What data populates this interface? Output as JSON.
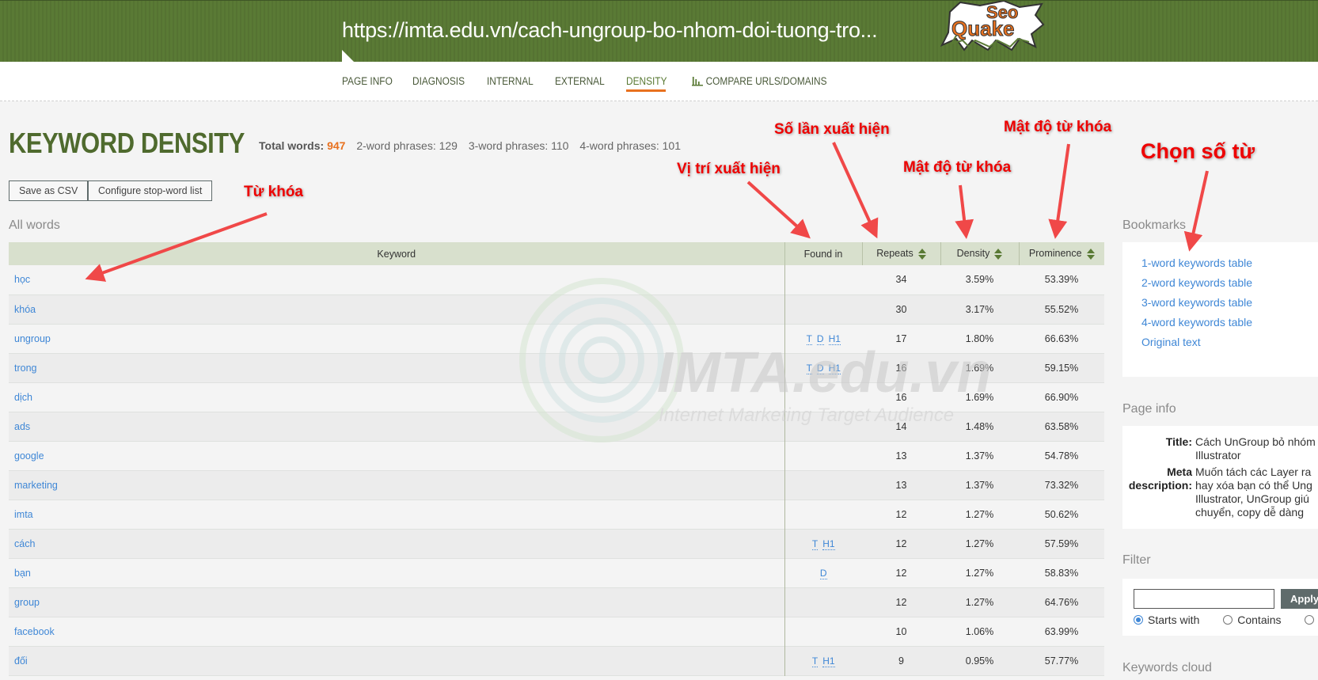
{
  "header": {
    "url": "https://imta.edu.vn/cach-ungroup-bo-nhom-doi-tuong-tro...",
    "logo_top": "Seo",
    "logo_bottom": "Quake"
  },
  "nav": {
    "items": [
      {
        "label": "PAGE INFO"
      },
      {
        "label": "DIAGNOSIS"
      },
      {
        "label": "INTERNAL"
      },
      {
        "label": "EXTERNAL"
      },
      {
        "label": "DENSITY",
        "active": true
      },
      {
        "label": "COMPARE URLS/DOMAINS",
        "icon": "bar-chart-icon"
      }
    ],
    "accent_color": "#e8711f"
  },
  "page": {
    "title": "KEYWORD DENSITY",
    "stats": {
      "total_words_label": "Total words:",
      "total_words": "947",
      "two_word_label": "2-word phrases:",
      "two_word": "129",
      "three_word_label": "3-word phrases:",
      "three_word": "110",
      "four_word_label": "4-word phrases:",
      "four_word": "101"
    },
    "buttons": {
      "save_csv": "Save as CSV",
      "configure": "Configure stop-word list"
    },
    "section_label": "All words"
  },
  "table": {
    "columns": {
      "keyword": "Keyword",
      "found_in": "Found in",
      "repeats": "Repeats",
      "density": "Density",
      "prominence": "Prominence"
    },
    "rows": [
      {
        "keyword": "học",
        "found_in": [],
        "repeats": "34",
        "density": "3.59%",
        "prominence": "53.39%"
      },
      {
        "keyword": "khóa",
        "found_in": [],
        "repeats": "30",
        "density": "3.17%",
        "prominence": "55.52%"
      },
      {
        "keyword": "ungroup",
        "found_in": [
          "T",
          "D",
          "H1"
        ],
        "repeats": "17",
        "density": "1.80%",
        "prominence": "66.63%"
      },
      {
        "keyword": "trong",
        "found_in": [
          "T",
          "D",
          "H1"
        ],
        "repeats": "16",
        "density": "1.69%",
        "prominence": "59.15%"
      },
      {
        "keyword": "dịch",
        "found_in": [],
        "repeats": "16",
        "density": "1.69%",
        "prominence": "66.90%"
      },
      {
        "keyword": "ads",
        "found_in": [],
        "repeats": "14",
        "density": "1.48%",
        "prominence": "63.58%"
      },
      {
        "keyword": "google",
        "found_in": [],
        "repeats": "13",
        "density": "1.37%",
        "prominence": "54.78%"
      },
      {
        "keyword": "marketing",
        "found_in": [],
        "repeats": "13",
        "density": "1.37%",
        "prominence": "73.32%"
      },
      {
        "keyword": "imta",
        "found_in": [],
        "repeats": "12",
        "density": "1.27%",
        "prominence": "50.62%"
      },
      {
        "keyword": "cách",
        "found_in": [
          "T",
          "H1"
        ],
        "repeats": "12",
        "density": "1.27%",
        "prominence": "57.59%"
      },
      {
        "keyword": "bạn",
        "found_in": [
          "D"
        ],
        "repeats": "12",
        "density": "1.27%",
        "prominence": "58.83%"
      },
      {
        "keyword": "group",
        "found_in": [],
        "repeats": "12",
        "density": "1.27%",
        "prominence": "64.76%"
      },
      {
        "keyword": "facebook",
        "found_in": [],
        "repeats": "10",
        "density": "1.06%",
        "prominence": "63.99%"
      },
      {
        "keyword": "đối",
        "found_in": [
          "T",
          "H1"
        ],
        "repeats": "9",
        "density": "0.95%",
        "prominence": "57.77%"
      }
    ]
  },
  "sidebar": {
    "bookmarks_label": "Bookmarks",
    "bookmarks": [
      "1-word keywords table",
      "2-word keywords table",
      "3-word keywords table",
      "4-word keywords table",
      "Original text"
    ],
    "page_info_label": "Page info",
    "page_info": {
      "title_label": "Title:",
      "title_lines": [
        "Cách UnGroup bỏ nhóm",
        "Illustrator"
      ],
      "meta_label_1": "Meta",
      "meta_label_2": "description:",
      "meta_lines": [
        "Muốn tách các Layer ra",
        "hay xóa bạn có thể Ung",
        "Illustrator, UnGroup giú",
        "chuyển, copy dễ dàng"
      ]
    },
    "filter_label": "Filter",
    "filter": {
      "value": "",
      "apply": "Apply",
      "options": [
        {
          "label": "Starts with",
          "checked": true
        },
        {
          "label": "Contains",
          "checked": false
        },
        {
          "label": "",
          "checked": false
        }
      ]
    },
    "cloud_label": "Keywords cloud"
  },
  "annotations": {
    "keyword": "Từ khóa",
    "position": "Vị trí xuất hiện",
    "repeats": "Số lần xuất hiện",
    "density": "Mật độ từ khóa",
    "prominence": "Mật độ từ khóa",
    "choose": "Chọn số từ"
  },
  "watermark": {
    "brand": "IMTA.edu.vn",
    "tagline": "Internet Marketing Target Audience"
  }
}
